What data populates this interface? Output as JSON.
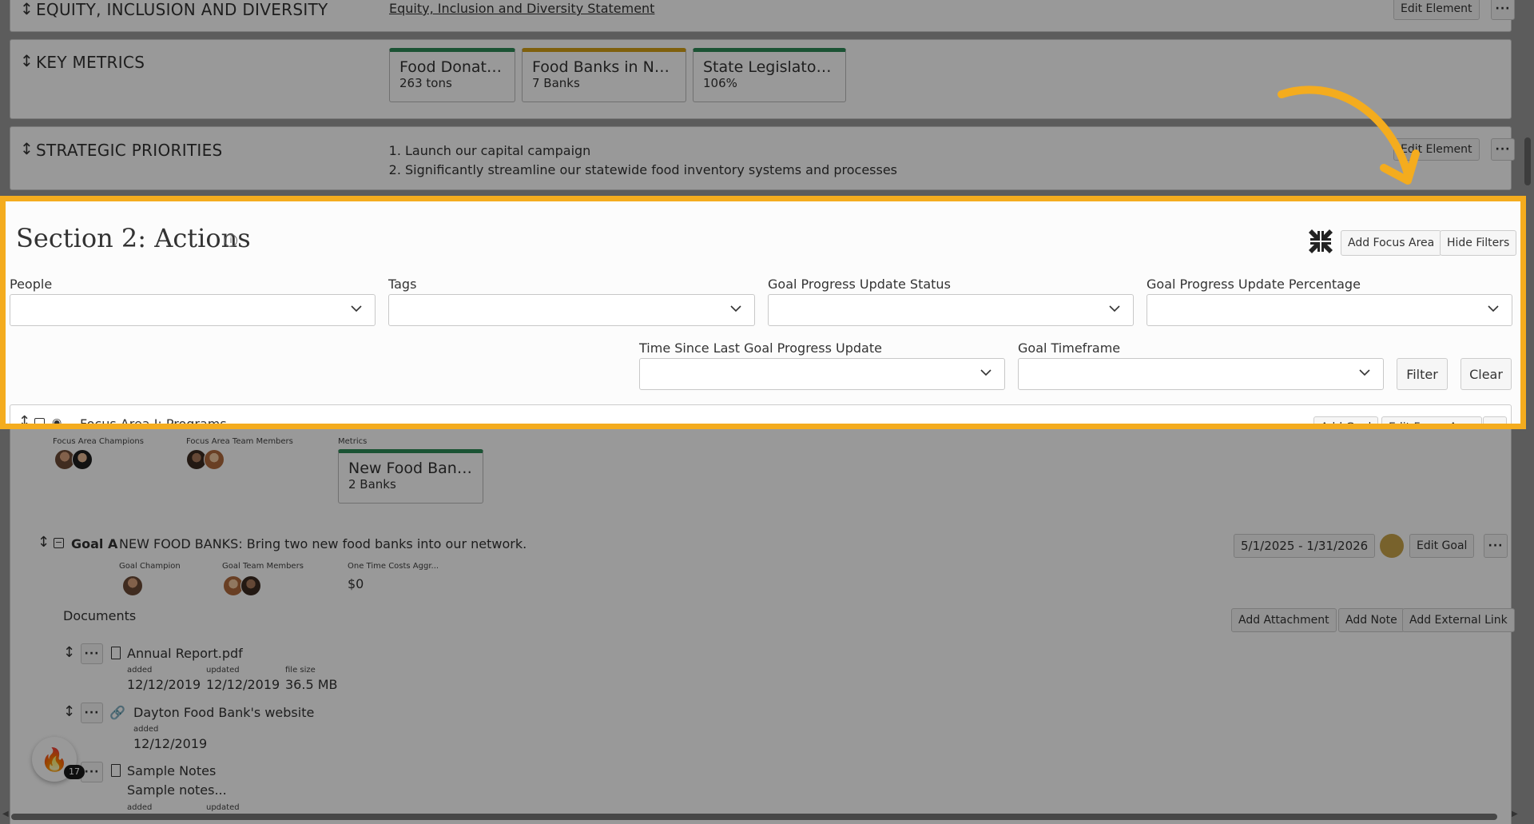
{
  "top_rows": {
    "equity": {
      "label": "EQUITY, INCLUSION AND DIVERSITY",
      "link": "Equity, Inclusion and Diversity Statement",
      "edit": "Edit Element",
      "more": "···"
    },
    "key_metrics": {
      "label": "KEY METRICS",
      "metrics": [
        {
          "title": "Food Donated",
          "value": "263 tons",
          "color": "#2e8b57"
        },
        {
          "title": "Food Banks in Net...",
          "value": "7 Banks",
          "color": "#d4a017"
        },
        {
          "title": "State Legislators...",
          "value": "106%",
          "color": "#2e8b57"
        }
      ]
    },
    "strategic": {
      "label": "STRATEGIC PRIORITIES",
      "items": [
        "Launch our capital campaign",
        "Significantly streamline our statewide food inventory systems and processes"
      ],
      "edit": "Edit Element",
      "more": "···"
    }
  },
  "section": {
    "title": "Section 2: Actions",
    "add_focus_area": "Add Focus Area",
    "hide_filters": "Hide Filters",
    "filters": {
      "people": "People",
      "tags": "Tags",
      "goal_status": "Goal Progress Update Status",
      "goal_percentage": "Goal Progress Update Percentage",
      "time_since": "Time Since Last Goal Progress Update",
      "goal_timeframe": "Goal Timeframe",
      "filter_btn": "Filter",
      "clear_btn": "Clear"
    }
  },
  "focus_area": {
    "title": "Focus Area I: Programs",
    "add_goal": "Add Goal",
    "edit_focus_area": "Edit Focus Area",
    "more": "···",
    "champions_label": "Focus Area Champions",
    "team_label": "Focus Area Team Members",
    "metrics_label": "Metrics",
    "metric": {
      "title": "New Food Banks",
      "value": "2 Banks"
    }
  },
  "goal": {
    "label": "Goal A",
    "text": "NEW FOOD BANKS: Bring two new food banks into our network.",
    "date_range": "5/1/2025 - 1/31/2026",
    "edit_goal": "Edit Goal",
    "more": "···",
    "status_color": "#c9a44a",
    "champion_label": "Goal Champion",
    "team_label": "Goal Team Members",
    "cost_label": "One Time Costs Aggr...",
    "cost_value": "$0"
  },
  "documents": {
    "heading": "Documents",
    "add_attachment": "Add Attachment",
    "add_note": "Add Note",
    "add_link": "Add External Link",
    "items": [
      {
        "name": "Annual Report.pdf",
        "added_label": "added",
        "added": "12/12/2019",
        "updated_label": "updated",
        "updated": "12/12/2019",
        "size_label": "file size",
        "size": "36.5 MB"
      },
      {
        "name": "Dayton Food Bank's website",
        "added_label": "added",
        "added": "12/12/2019"
      },
      {
        "name": "Sample Notes",
        "preview": "Sample notes...",
        "added_label": "added",
        "updated_label": "updated"
      }
    ]
  },
  "badge": {
    "count": "17"
  },
  "colors": {
    "highlight": "#f4ac1e",
    "green": "#2e8b57",
    "yellow": "#d4a017"
  }
}
